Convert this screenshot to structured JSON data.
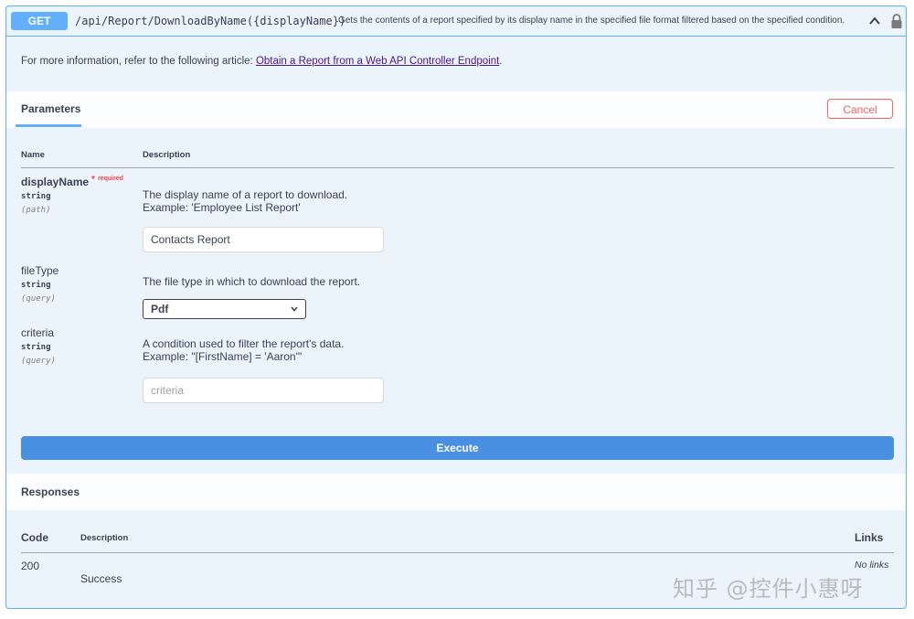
{
  "summary": {
    "method": "GET",
    "path": "/api/Report/DownloadByName({displayName})",
    "description": "Gets the contents of a report specified by its display name in the specified file format filtered based on the specified condition."
  },
  "info": {
    "prefix": "For more information, refer to the following article: ",
    "link_text": "Obtain a Report from a Web API Controller Endpoint",
    "suffix": "."
  },
  "parameters_section": {
    "tab_label": "Parameters",
    "cancel_label": "Cancel",
    "col_name": "Name",
    "col_description": "Description"
  },
  "params": [
    {
      "name": "displayName",
      "required_star": "*",
      "required_text": "required",
      "type": "string",
      "in": "(path)",
      "description_line1": "The display name of a report to download.",
      "description_line2": "Example: 'Employee List Report'",
      "value": "Contacts Report"
    },
    {
      "name": "fileType",
      "type": "string",
      "in": "(query)",
      "description_line1": "The file type in which to download the report.",
      "selected": "Pdf"
    },
    {
      "name": "criteria",
      "type": "string",
      "in": "(query)",
      "description_line1": "A condition used to filter the report's data.",
      "description_line2": "Example: \"[FirstName] = 'Aaron'\"",
      "placeholder": "criteria"
    }
  ],
  "execute_label": "Execute",
  "responses": {
    "title": "Responses",
    "col_code": "Code",
    "col_description": "Description",
    "col_links": "Links",
    "rows": [
      {
        "code": "200",
        "description": "Success",
        "links": "No links"
      }
    ]
  },
  "watermark": "知乎 @控件小惠呀",
  "colors": {
    "get_method": "#61affe",
    "execute": "#4990e2",
    "cancel": "#ff6060",
    "required": "#ff4040"
  }
}
